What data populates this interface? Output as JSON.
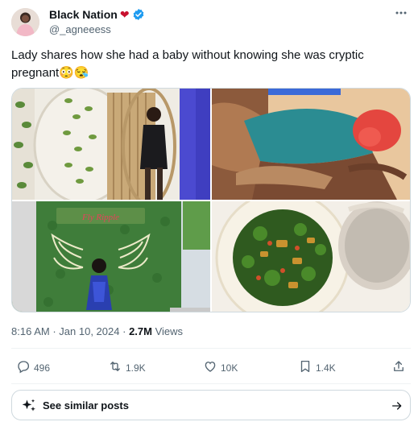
{
  "author": {
    "display_name": "Black Nation",
    "name_emoji": "❤",
    "handle": "@_agneeess",
    "verified_color": "#1d9bf0",
    "avatar": "avatar-photo"
  },
  "tweet": {
    "text_line1": "Lady shares how she had a baby without knowing she was cryptic",
    "text_line2": "pregnant😳😪"
  },
  "media": {
    "tiles": [
      "woman-posing-photo",
      "woman-sleeping-photo",
      "angel-wings-wall-photo",
      "vegetable-soup-photo"
    ],
    "sign_text": "Fly Ripple"
  },
  "meta": {
    "time": "8:16 AM",
    "separator": "·",
    "date": "Jan 10, 2024",
    "views_count": "2.7M",
    "views_label": "Views"
  },
  "actions": {
    "replies": "496",
    "reposts": "1.9K",
    "likes": "10K",
    "bookmarks": "1.4K"
  },
  "similar": {
    "label": "See similar posts"
  },
  "colors": {
    "text": "#0f1419",
    "secondary": "#536471",
    "border": "#cfd9de",
    "accent": "#1d9bf0"
  }
}
